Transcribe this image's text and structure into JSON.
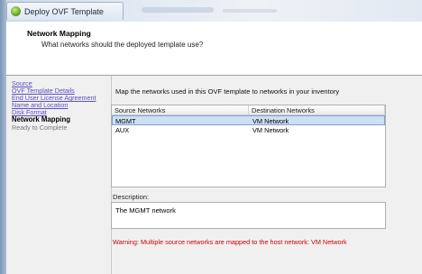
{
  "window": {
    "title": "Deploy OVF Template"
  },
  "header": {
    "title": "Network Mapping",
    "subtitle": "What networks should the deployed template use?"
  },
  "nav": {
    "items": [
      {
        "label": "Source",
        "state": "link"
      },
      {
        "label": "OVF Template Details",
        "state": "link"
      },
      {
        "label": "End User License Agreement",
        "state": "link"
      },
      {
        "label": "Name and Location",
        "state": "link"
      },
      {
        "label": "Disk Format",
        "state": "link"
      },
      {
        "label": "Network Mapping",
        "state": "current"
      },
      {
        "label": "Ready to Complete",
        "state": "future"
      }
    ]
  },
  "main": {
    "instruction": "Map the networks used in this OVF template to networks in your inventory",
    "table": {
      "columns": [
        "Source Networks",
        "Destination Networks"
      ],
      "rows": [
        {
          "source": "MGMT",
          "destination": "VM Network",
          "selected": true
        },
        {
          "source": "AUX",
          "destination": "VM Network",
          "selected": false
        }
      ]
    },
    "description_label": "Description:",
    "description_text": "The MGMT network",
    "warning": "Warning: Multiple source networks are mapped to the host network: VM Network"
  },
  "colors": {
    "link": "#5a4fc2",
    "warning": "#d40000",
    "selection": "#cde0f3"
  }
}
